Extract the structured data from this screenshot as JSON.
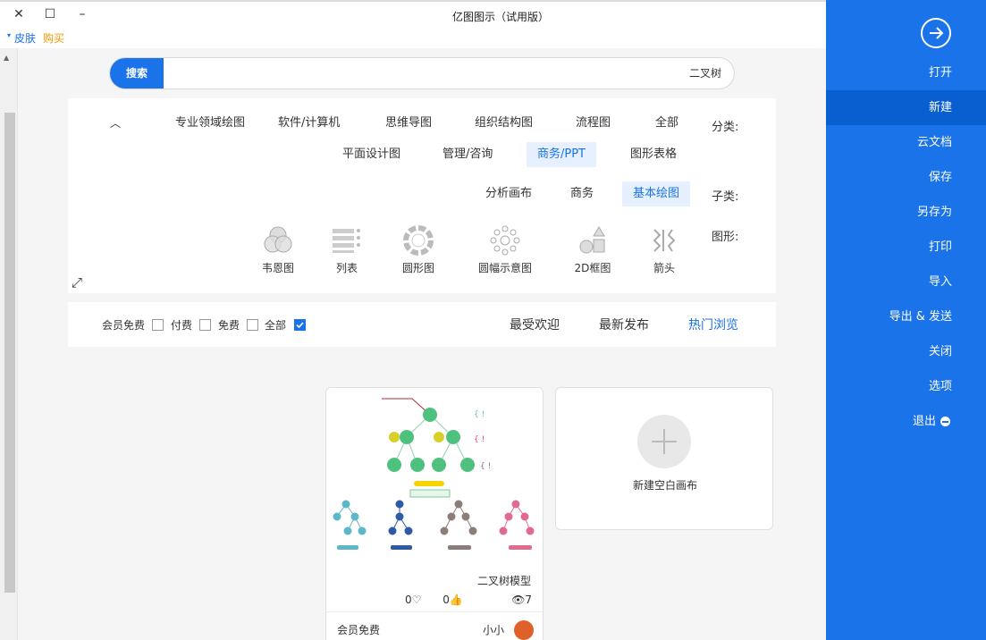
{
  "window": {
    "title": "亿图图示（试用版）",
    "close": "✕",
    "maximize": "☐",
    "minimize": "–"
  },
  "menu": {
    "skin": "皮肤",
    "buy": "购买"
  },
  "sidebar": {
    "items": [
      {
        "label": "打开"
      },
      {
        "label": "新建"
      },
      {
        "label": "云文档"
      },
      {
        "label": "保存"
      },
      {
        "label": "另存为"
      },
      {
        "label": "打印"
      },
      {
        "label": "导入"
      },
      {
        "label": "导出 & 发送"
      },
      {
        "label": "关闭"
      },
      {
        "label": "选项"
      },
      {
        "label": "退出"
      }
    ]
  },
  "search": {
    "button": "搜索",
    "value": "二叉树"
  },
  "filters": {
    "category_label": "分类:",
    "categories": [
      "全部",
      "流程图",
      "组织结构图",
      "思维导图",
      "软件/计算机",
      "专业领域绘图"
    ],
    "categories2": [
      "图形表格",
      "商务/PPT",
      "管理/咨询",
      "平面设计图"
    ],
    "subcategory_label": "子类:",
    "subcategories": [
      "基本绘图",
      "商务",
      "分析画布"
    ],
    "shape_label": "图形:",
    "shapes": [
      "箭头",
      "2D框图",
      "圆幅示意图",
      "圆形图",
      "列表",
      "韦恩图"
    ]
  },
  "sort": {
    "tabs": [
      "热门浏览",
      "最新发布",
      "最受欢迎"
    ],
    "checks": [
      "全部",
      "免费",
      "付费",
      "会员免费"
    ]
  },
  "cards": {
    "blank": {
      "label": "新建空白画布"
    },
    "template": {
      "title": "二叉树模型",
      "views": "7",
      "likes": "0",
      "favs": "0",
      "author": "小小",
      "price": "会员免费"
    }
  },
  "colors": {
    "accent": "#1a73e8",
    "node": "#4fc17e"
  }
}
